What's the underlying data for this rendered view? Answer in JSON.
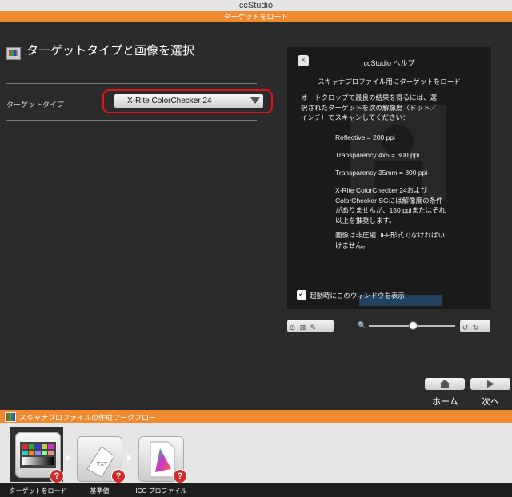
{
  "window": {
    "title": "ccStudio"
  },
  "header": {
    "section": "ターゲットをロード"
  },
  "page": {
    "title": "ターゲットタイプと画像を選択"
  },
  "form": {
    "target_type_label": "ターゲットタイプ",
    "target_type_value": "X-Rite ColorChecker 24"
  },
  "help": {
    "close": "×",
    "title": "ccStudio ヘルプ",
    "subtitle": "スキャナプロファイル用にターゲットをロード",
    "intro": [
      "オートクロップで最良の結果を得るには、選",
      "択されたターゲットを次の解像度（ドット／",
      "インチ）でスキャンしてください："
    ],
    "res_reflective": "Reflective = 200 ppi",
    "res_trans_4x5": "Transparency 4x5 = 300 ppi",
    "res_trans_35": "Transparency 35mm = 800 ppi",
    "note1": [
      "X-Rite ColorChecker 24および",
      "ColorChecker SGには解像度の条件",
      "がありませんが、150 ppiまたはそれ",
      "以上を推奨します。"
    ],
    "note2": [
      "画像は非圧縮TIFF形式でなければい",
      "けません。"
    ],
    "checkbox_label": "起動時にこのウィンドウを表示",
    "checkbox_mark": "✓"
  },
  "nav": {
    "home": "ホーム",
    "next": "次へ"
  },
  "workflow": {
    "title": "スキャナプロファイルの作成ワークフロー",
    "steps": [
      {
        "label": "ターゲットをロード"
      },
      {
        "label": "基準値"
      },
      {
        "label": "ICC プロファイル"
      }
    ],
    "badge": "?"
  },
  "colors": {
    "accent": "#f08a30",
    "highlight_ring": "#e0141b",
    "badge": "#d12a2a"
  }
}
